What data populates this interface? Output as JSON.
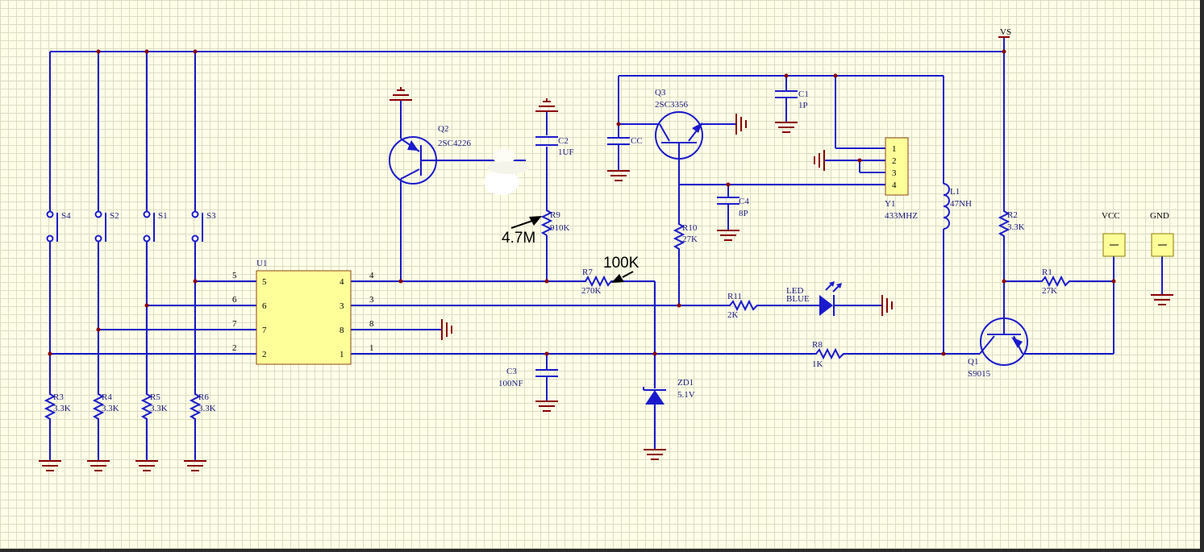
{
  "schematic": {
    "power": {
      "vs": "VS",
      "vcc": "VCC",
      "gnd": "GND"
    },
    "ic": {
      "ref": "U1",
      "pins_left": [
        "5",
        "6",
        "7",
        "2"
      ],
      "pins_right": [
        "4",
        "3",
        "8",
        "1"
      ],
      "outer_left": [
        "5",
        "6",
        "7",
        "2"
      ],
      "outer_right": [
        "4",
        "3",
        "8",
        "1"
      ]
    },
    "switches": [
      {
        "ref": "S4"
      },
      {
        "ref": "S2"
      },
      {
        "ref": "S1"
      },
      {
        "ref": "S3"
      }
    ],
    "pulldowns": [
      {
        "ref": "R3",
        "value": "3.3K"
      },
      {
        "ref": "R4",
        "value": "3.3K"
      },
      {
        "ref": "R5",
        "value": "3.3K"
      },
      {
        "ref": "R6",
        "value": "3.3K"
      }
    ],
    "q2": {
      "ref": "Q2",
      "part": "2SC4226"
    },
    "c2": {
      "ref": "C2",
      "value": "1UF"
    },
    "r9": {
      "ref": "R9",
      "value": "910K",
      "note": "4.7M"
    },
    "r7": {
      "ref": "R7",
      "value": "270K",
      "note": "100K"
    },
    "c3": {
      "ref": "C3",
      "value": "100NF"
    },
    "zd1": {
      "ref": "ZD1",
      "value": "5.1V"
    },
    "q3": {
      "ref": "Q3",
      "part": "2SC3356"
    },
    "cc": {
      "ref": "CC"
    },
    "c1": {
      "ref": "C1",
      "value": "1P"
    },
    "c4": {
      "ref": "C4",
      "value": "8P"
    },
    "r10": {
      "ref": "R10",
      "value": "27K"
    },
    "y1": {
      "ref": "Y1",
      "value": "433MHZ",
      "pins": [
        "1",
        "2",
        "3",
        "4"
      ]
    },
    "l1": {
      "ref": "L1",
      "value": "47NH"
    },
    "r11": {
      "ref": "R11",
      "value": "2K"
    },
    "led": {
      "ref": "LED",
      "value": "BLUE"
    },
    "r8": {
      "ref": "R8",
      "value": "1K"
    },
    "r2": {
      "ref": "R2",
      "value": "3.3K"
    },
    "r1": {
      "ref": "R1",
      "value": "27K"
    },
    "q1": {
      "ref": "Q1",
      "part": "S9015"
    },
    "colors": {
      "wire": "#1a1acc",
      "ground": "#8b0000",
      "connector": "#ffff99",
      "background": "#ffffe8"
    }
  }
}
